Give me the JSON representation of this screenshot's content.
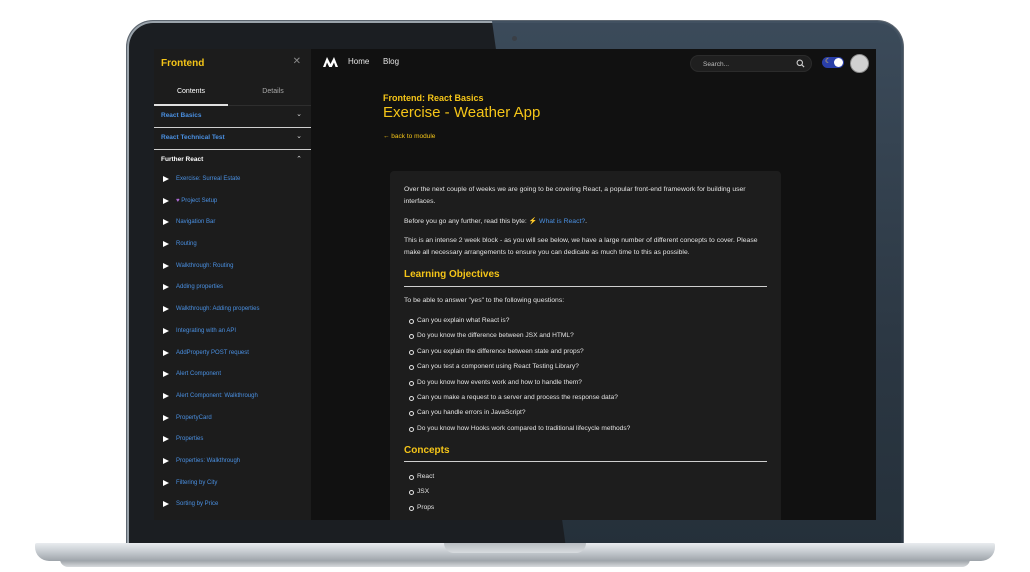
{
  "sidebar": {
    "title": "Frontend",
    "tabs": [
      "Contents",
      "Details"
    ],
    "sections": [
      {
        "label": "React Basics",
        "chevron": "chevron-down-icon"
      },
      {
        "label": "React Technical Test",
        "chevron": "chevron-down-icon"
      },
      {
        "label": "Further React",
        "chevron": "chevron-up-icon"
      }
    ],
    "items": [
      "Exercise: Surreal Estate",
      "Project Setup",
      "Navigation Bar",
      "Routing",
      "Walkthrough: Routing",
      "Adding properties",
      "Walkthrough: Adding properties",
      "Integrating with an API",
      "AddProperty POST request",
      "Alert Component",
      "Alert Component: Walkthrough",
      "PropertyCard",
      "Properties",
      "Properties: Walkthrough",
      "Filtering by City",
      "Sorting by Price"
    ],
    "heart_item_index": 1
  },
  "topbar": {
    "nav": [
      "Home",
      "Blog"
    ],
    "search_placeholder": "Search...",
    "theme_toggle": "dark"
  },
  "page": {
    "breadcrumb": "Frontend: React Basics",
    "title": "Exercise - Weather App",
    "back_link": "← back to module",
    "intro_1": "Over the next couple of weeks we are going to be covering React, a popular front-end framework for building user interfaces.",
    "intro_2_prefix": "Before you go any further, read this byte: ",
    "intro_2_link": "What is React?",
    "intro_2_suffix": ".",
    "intro_3": "This is an intense 2 week block - as you will see below, we have a large number of different concepts to cover. Please make all necessary arrangements to ensure you can dedicate as much time to this as possible.",
    "objectives_heading": "Learning Objectives",
    "objectives_intro": "To be able to answer \"yes\" to the following questions:",
    "objectives": [
      "Can you explain what React is?",
      "Do you know the difference between JSX and HTML?",
      "Can you explain the difference between state and props?",
      "Can you test a component using React Testing Library?",
      "Do you know how events work and how to handle them?",
      "Can you make a request to a server and process the response data?",
      "Can you handle errors in JavaScript?",
      "Do you know how Hooks work compared to traditional lifecycle methods?"
    ],
    "concepts_heading": "Concepts",
    "concepts": [
      "React",
      "JSX",
      "Props"
    ]
  },
  "colors": {
    "accent": "#f5c518",
    "link": "#4a90e2",
    "background": "#111111",
    "sidebar": "#1c1c1c",
    "card": "#1d1d1d"
  }
}
